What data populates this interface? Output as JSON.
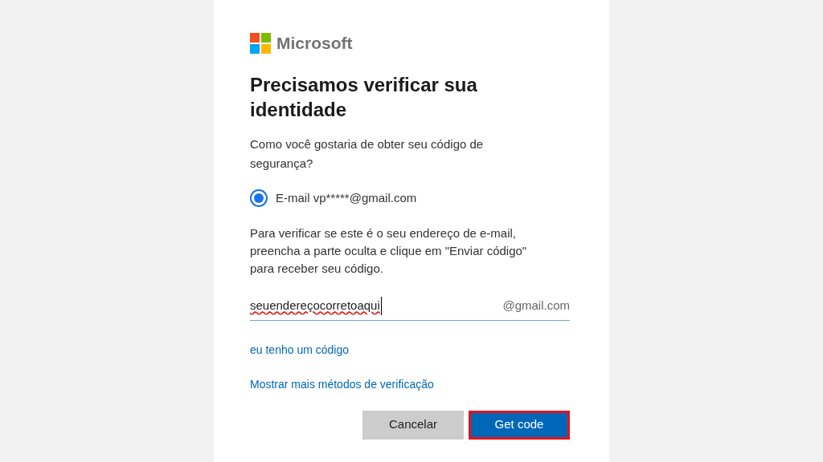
{
  "logo": {
    "text": "Microsoft"
  },
  "title": "Precisamos verificar sua identidade",
  "question": "Como você gostaria de obter seu código de segurança?",
  "options": [
    {
      "label": "E-mail vp*****@gmail.com",
      "selected": true
    }
  ],
  "instructions": "Para verificar se este é o seu endereço de e-mail, preencha a parte oculta e clique em \"Enviar código\" para receber seu código.",
  "email_field": {
    "value": "seuendereçocorretoaqui",
    "suffix": "@gmail.com"
  },
  "links": [
    "eu tenho um código",
    "Mostrar mais métodos de verificação"
  ],
  "buttons": [
    {
      "label": "Cancelar",
      "kind": "secondary",
      "highlighted": false
    },
    {
      "label": "Get code",
      "kind": "primary",
      "highlighted": true
    }
  ]
}
